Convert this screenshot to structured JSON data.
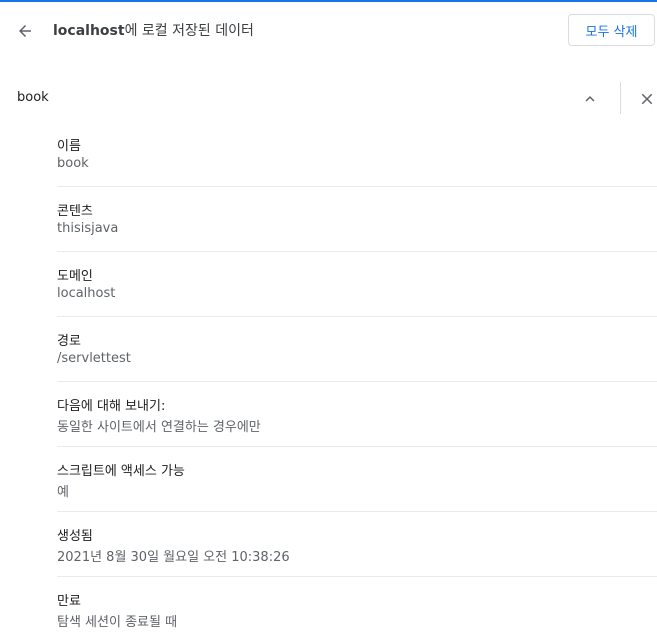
{
  "header": {
    "host": "localhost",
    "title_suffix": "에 로컬 저장된 데이터",
    "remove_all_label": "모두 삭제"
  },
  "cookie": {
    "name": "book"
  },
  "fields": [
    {
      "label": "이름",
      "value": "book"
    },
    {
      "label": "콘텐츠",
      "value": "thisisjava"
    },
    {
      "label": "도메인",
      "value": "localhost"
    },
    {
      "label": "경로",
      "value": "/servlettest"
    },
    {
      "label": "다음에 대해 보내기:",
      "value": "동일한 사이트에서 연결하는 경우에만"
    },
    {
      "label": "스크립트에 액세스 가능",
      "value": "예"
    },
    {
      "label": "생성됨",
      "value": "2021년 8월 30일 월요일 오전 10:38:26"
    },
    {
      "label": "만료",
      "value": "탐색 세션이 종료될 때"
    }
  ],
  "colors": {
    "accent": "#1a73e8",
    "divider": "#e8eaed",
    "secondary_text": "#5f6368"
  },
  "icons": {
    "back": "arrow-back-icon",
    "collapse": "chevron-up-icon",
    "remove": "close-icon"
  }
}
